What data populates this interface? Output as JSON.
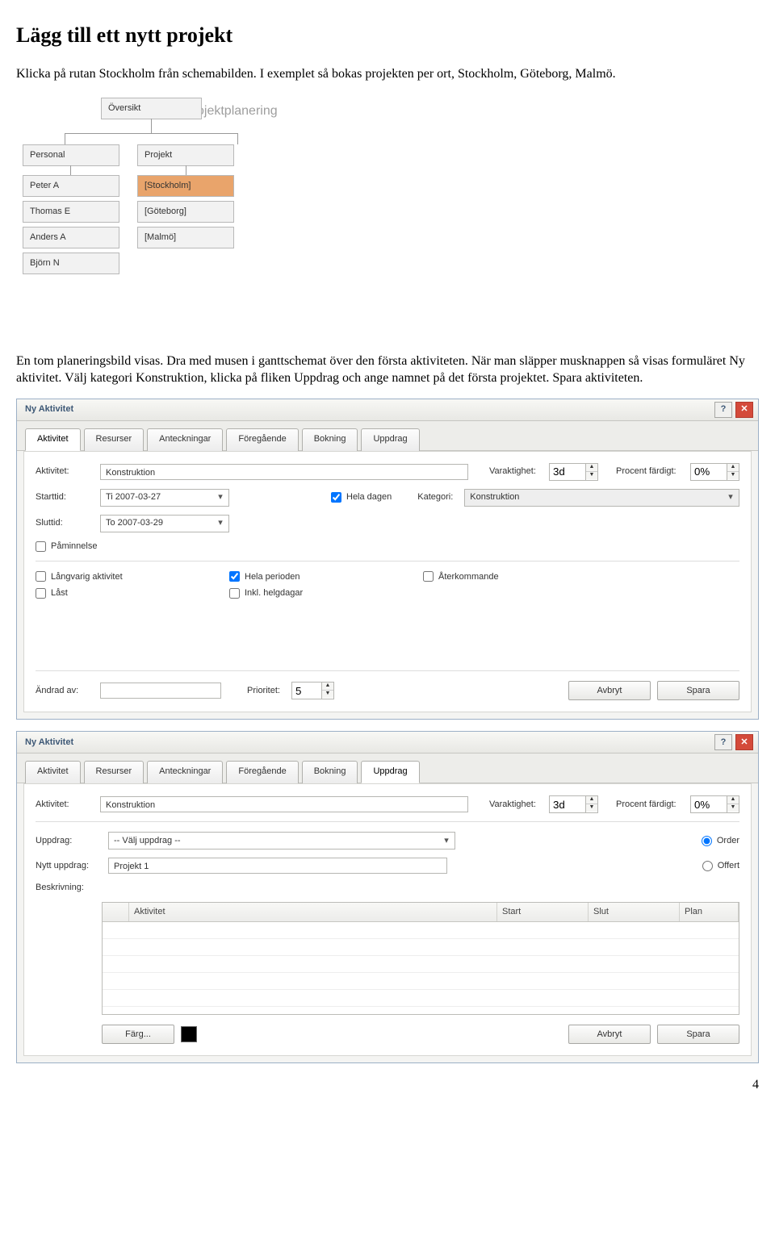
{
  "doc": {
    "heading": "Lägg till ett nytt projekt",
    "para1": "Klicka på rutan Stockholm från schemabilden. I exemplet så bokas projekten per ort, Stockholm, Göteborg, Malmö.",
    "para2": "En tom planeringsbild visas. Dra med musen i ganttschemat över den första aktiviteten. När man släpper musknappen så visas formuläret Ny aktivitet. Välj kategori Konstruktion, klicka på fliken Uppdrag och ange namnet på det första projektet. Spara aktiviteten.",
    "page_number": "4"
  },
  "schema": {
    "title": "Projektplanering",
    "root": "Översikt",
    "col1_header": "Personal",
    "col2_header": "Projekt",
    "col1": [
      "Peter A",
      "Thomas E",
      "Anders A",
      "Björn N"
    ],
    "col2": [
      "[Stockholm]",
      "[Göteborg]",
      "[Malmö]"
    ]
  },
  "dlg": {
    "title": "Ny Aktivitet",
    "tabs": [
      "Aktivitet",
      "Resurser",
      "Anteckningar",
      "Föregående",
      "Bokning",
      "Uppdrag"
    ],
    "labels": {
      "aktivitet": "Aktivitet:",
      "varaktighet": "Varaktighet:",
      "procent": "Procent färdigt:",
      "starttid": "Starttid:",
      "hela_dagen": "Hela dagen",
      "kategori": "Kategori:",
      "sluttid": "Sluttid:",
      "paminnelse": "Påminnelse",
      "langvarig": "Långvarig aktivitet",
      "last": "Låst",
      "hela_perioden": "Hela perioden",
      "inkl_helg": "Inkl. helgdagar",
      "aterkommande": "Återkommande",
      "andrad_av": "Ändrad av:",
      "prioritet": "Prioritet:",
      "avbryt": "Avbryt",
      "spara": "Spara",
      "uppdrag": "Uppdrag:",
      "nytt_uppdrag": "Nytt uppdrag:",
      "beskrivning": "Beskrivning:",
      "order": "Order",
      "offert": "Offert",
      "farg": "Färg...",
      "th_aktivitet": "Aktivitet",
      "th_start": "Start",
      "th_slut": "Slut",
      "th_plan": "Plan"
    },
    "values": {
      "aktivitet": "Konstruktion",
      "varaktighet": "3d",
      "procent": "0%",
      "starttid": "Ti 2007-03-27",
      "sluttid": "To 2007-03-29",
      "kategori": "Konstruktion",
      "prioritet": "5",
      "uppdrag_sel": "-- Välj uppdrag --",
      "nytt_uppdrag": "Projekt 1"
    }
  }
}
